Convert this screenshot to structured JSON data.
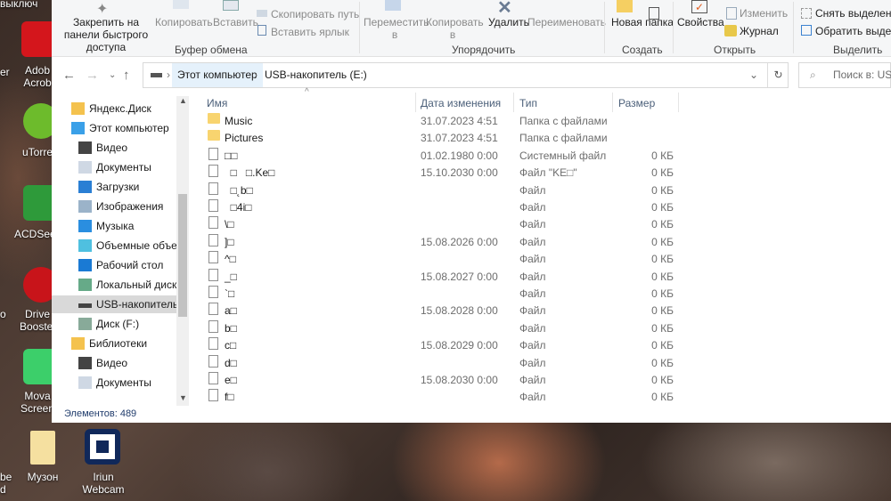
{
  "desktop": {
    "top_text": "выключ",
    "icons": [
      {
        "label": "Adob Acrob"
      },
      {
        "label": "uTorre"
      },
      {
        "label": "ACDSee"
      },
      {
        "label": "Drive Booster"
      },
      {
        "label": "Mova Screen"
      },
      {
        "label": "Музон"
      },
      {
        "label": "Iriun Webcam"
      }
    ],
    "left_partial": [
      "er",
      "o",
      "be",
      "d"
    ]
  },
  "ribbon": {
    "clipboard": {
      "pin": "Закрепить на панели быстрого доступа",
      "copy": "Копировать",
      "paste": "Вставить",
      "copy_path": "Скопировать путь",
      "paste_shortcut": "Вставить ярлык",
      "group": "Буфер обмена"
    },
    "organize": {
      "move": "Переместить в",
      "copy_to": "Копировать в",
      "delete": "Удалить",
      "rename": "Переименовать",
      "group": "Упорядочить"
    },
    "new": {
      "new_folder": "Новая папка",
      "group": "Создать"
    },
    "open": {
      "properties": "Свойства",
      "edit": "Изменить",
      "history": "Журнал",
      "group": "Открыть"
    },
    "select": {
      "deselect": "Снять выделение",
      "invert": "Обратить выделе",
      "group": "Выделить"
    }
  },
  "address": {
    "crumbs": [
      "Этот компьютер",
      "USB-накопитель (E:)"
    ],
    "search_placeholder": "Поиск в: USB"
  },
  "sidebar": {
    "items": [
      {
        "label": "Яндекс.Диск",
        "icon": "yandex-disk-icon",
        "level": 0
      },
      {
        "label": "Этот компьютер",
        "icon": "computer-icon",
        "level": 0
      },
      {
        "label": "Видео",
        "icon": "video-icon",
        "level": 1
      },
      {
        "label": "Документы",
        "icon": "documents-icon",
        "level": 1
      },
      {
        "label": "Загрузки",
        "icon": "downloads-icon",
        "level": 1
      },
      {
        "label": "Изображения",
        "icon": "pictures-icon",
        "level": 1
      },
      {
        "label": "Музыка",
        "icon": "music-icon",
        "level": 1
      },
      {
        "label": "Объемные объект",
        "icon": "3d-objects-icon",
        "level": 1
      },
      {
        "label": "Рабочий стол",
        "icon": "desktop-icon",
        "level": 1
      },
      {
        "label": "Локальный диск (",
        "icon": "local-disk-icon",
        "level": 1
      },
      {
        "label": "USB-накопитель (",
        "icon": "usb-drive-icon",
        "level": 1,
        "selected": true
      },
      {
        "label": "Диск  (F:)",
        "icon": "disk-icon",
        "level": 1
      },
      {
        "label": "Библиотеки",
        "icon": "libraries-icon",
        "level": 0
      },
      {
        "label": "Видео",
        "icon": "video-icon",
        "level": 1
      },
      {
        "label": "Документы",
        "icon": "documents-icon",
        "level": 1
      }
    ]
  },
  "columns": {
    "name": "Имя",
    "date": "Дата изменения",
    "type": "Тип",
    "size": "Размер"
  },
  "files": [
    {
      "name": "Music",
      "date": "31.07.2023 4:51",
      "type": "Папка с файлами",
      "size": "",
      "kind": "folder"
    },
    {
      "name": "Pictures",
      "date": "31.07.2023 4:51",
      "type": "Папка с файлами",
      "size": "",
      "kind": "folder"
    },
    {
      "name": "□□",
      "date": "01.02.1980 0:00",
      "type": "Системный файл",
      "size": "0 КБ",
      "kind": "system"
    },
    {
      "name": "  □   □.Ke□",
      "date": "15.10.2030 0:00",
      "type": "Файл \"KE□\"",
      "size": "0 КБ",
      "kind": "file"
    },
    {
      "name": "  □˛b□",
      "date": "",
      "type": "Файл",
      "size": "0 КБ",
      "kind": "file"
    },
    {
      "name": "  □4i□",
      "date": "",
      "type": "Файл",
      "size": "0 КБ",
      "kind": "file"
    },
    {
      "name": "\\□",
      "date": "",
      "type": "Файл",
      "size": "0 КБ",
      "kind": "file"
    },
    {
      "name": "]□",
      "date": "15.08.2026 0:00",
      "type": "Файл",
      "size": "0 КБ",
      "kind": "file"
    },
    {
      "name": "^□",
      "date": "",
      "type": "Файл",
      "size": "0 КБ",
      "kind": "file"
    },
    {
      "name": "_□",
      "date": "15.08.2027 0:00",
      "type": "Файл",
      "size": "0 КБ",
      "kind": "file"
    },
    {
      "name": "`□",
      "date": "",
      "type": "Файл",
      "size": "0 КБ",
      "kind": "file"
    },
    {
      "name": "a□",
      "date": "15.08.2028 0:00",
      "type": "Файл",
      "size": "0 КБ",
      "kind": "file"
    },
    {
      "name": "b□",
      "date": "",
      "type": "Файл",
      "size": "0 КБ",
      "kind": "file"
    },
    {
      "name": "c□",
      "date": "15.08.2029 0:00",
      "type": "Файл",
      "size": "0 КБ",
      "kind": "file"
    },
    {
      "name": "d□",
      "date": "",
      "type": "Файл",
      "size": "0 КБ",
      "kind": "file"
    },
    {
      "name": "e□",
      "date": "15.08.2030 0:00",
      "type": "Файл",
      "size": "0 КБ",
      "kind": "file"
    },
    {
      "name": "f□",
      "date": "",
      "type": "Файл",
      "size": "0 КБ",
      "kind": "file"
    }
  ],
  "status": {
    "count": "Элементов: 489"
  }
}
